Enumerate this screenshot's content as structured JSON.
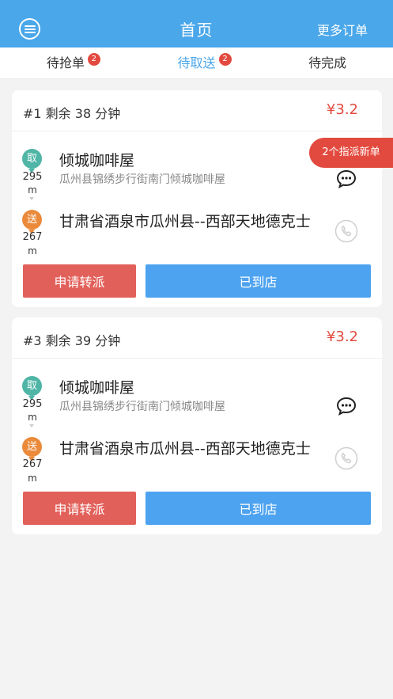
{
  "header": {
    "title": "首页",
    "more_orders": "更多订单"
  },
  "tabs": [
    {
      "label": "待抢单",
      "badge": "2",
      "active": false
    },
    {
      "label": "待取送",
      "badge": "2",
      "active": true
    },
    {
      "label": "待完成",
      "badge": "",
      "active": false
    }
  ],
  "assign_tag": "2个指派新单",
  "orders": [
    {
      "title": "#1 剩余 38 分钟",
      "price": "¥3.2",
      "pickup": {
        "pin": "取",
        "distance": "295",
        "unit": "m",
        "name": "倾城咖啡屋",
        "address": "瓜州县锦绣步行街南门倾城咖啡屋"
      },
      "deliver": {
        "pin": "送",
        "distance": "267",
        "unit": "m",
        "name": "甘肃省酒泉市瓜州县--西部天地德克士"
      },
      "transfer_label": "申请转派",
      "arrived_label": "已到店"
    },
    {
      "title": "#3 剩余 39 分钟",
      "price": "¥3.2",
      "pickup": {
        "pin": "取",
        "distance": "295",
        "unit": "m",
        "name": "倾城咖啡屋",
        "address": "瓜州县锦绣步行街南门倾城咖啡屋"
      },
      "deliver": {
        "pin": "送",
        "distance": "267",
        "unit": "m",
        "name": "甘肃省酒泉市瓜州县--西部天地德克士"
      },
      "transfer_label": "申请转派",
      "arrived_label": "已到店"
    }
  ],
  "colors": {
    "brand": "#4aa7ea",
    "price": "#e34a3f",
    "pickup_pin": "#4fb5a6",
    "deliver_pin": "#ea8a3a",
    "transfer_btn": "#e2605a",
    "arrived_btn": "#4ea3f0"
  }
}
